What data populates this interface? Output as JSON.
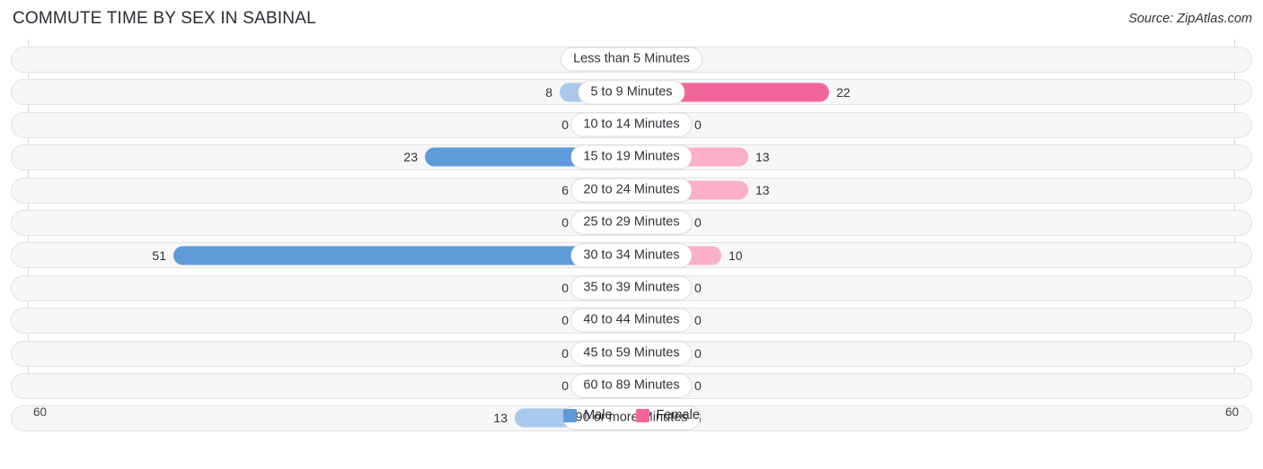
{
  "header": {
    "title": "COMMUTE TIME BY SEX IN SABINAL",
    "source": "Source: ZipAtlas.com"
  },
  "axis": {
    "left_label": "60",
    "right_label": "60"
  },
  "legend": {
    "items": [
      {
        "label": "Male",
        "color": "#5e9bd8"
      },
      {
        "label": "Female",
        "color": "#f2659b"
      }
    ]
  },
  "colors": {
    "male_light": "#a9c9ec",
    "male_strong": "#5e9bd8",
    "female_light": "#fbafc9",
    "female_strong": "#f2659b",
    "track": "#f7f7f7",
    "track_border": "#e3e3e3",
    "gridline": "#d8d8d8"
  },
  "chart_data": {
    "type": "bar",
    "title": "COMMUTE TIME BY SEX IN SABINAL",
    "subtitle": "",
    "orientation": "horizontal-diverging",
    "xlabel": "",
    "ylabel": "",
    "xlim": [
      60,
      60
    ],
    "axis_max": 60,
    "grid": true,
    "legend_position": "bottom-center",
    "categories": [
      "Less than 5 Minutes",
      "5 to 9 Minutes",
      "10 to 14 Minutes",
      "15 to 19 Minutes",
      "20 to 24 Minutes",
      "25 to 29 Minutes",
      "30 to 34 Minutes",
      "35 to 39 Minutes",
      "40 to 44 Minutes",
      "45 to 59 Minutes",
      "60 to 89 Minutes",
      "90 or more Minutes"
    ],
    "series": [
      {
        "name": "Male",
        "values": [
          0,
          8,
          0,
          23,
          6,
          0,
          51,
          0,
          0,
          0,
          0,
          13
        ]
      },
      {
        "name": "Female",
        "values": [
          0,
          22,
          0,
          13,
          13,
          0,
          10,
          0,
          0,
          0,
          0,
          6
        ]
      }
    ]
  },
  "rows": [
    {
      "category": "Less than 5 Minutes",
      "male": "0",
      "female": "0"
    },
    {
      "category": "5 to 9 Minutes",
      "male": "8",
      "female": "22"
    },
    {
      "category": "10 to 14 Minutes",
      "male": "0",
      "female": "0"
    },
    {
      "category": "15 to 19 Minutes",
      "male": "23",
      "female": "13"
    },
    {
      "category": "20 to 24 Minutes",
      "male": "6",
      "female": "13"
    },
    {
      "category": "25 to 29 Minutes",
      "male": "0",
      "female": "0"
    },
    {
      "category": "30 to 34 Minutes",
      "male": "51",
      "female": "10"
    },
    {
      "category": "35 to 39 Minutes",
      "male": "0",
      "female": "0"
    },
    {
      "category": "40 to 44 Minutes",
      "male": "0",
      "female": "0"
    },
    {
      "category": "45 to 59 Minutes",
      "male": "0",
      "female": "0"
    },
    {
      "category": "60 to 89 Minutes",
      "male": "0",
      "female": "0"
    },
    {
      "category": "90 or more Minutes",
      "male": "13",
      "female": "6"
    }
  ]
}
